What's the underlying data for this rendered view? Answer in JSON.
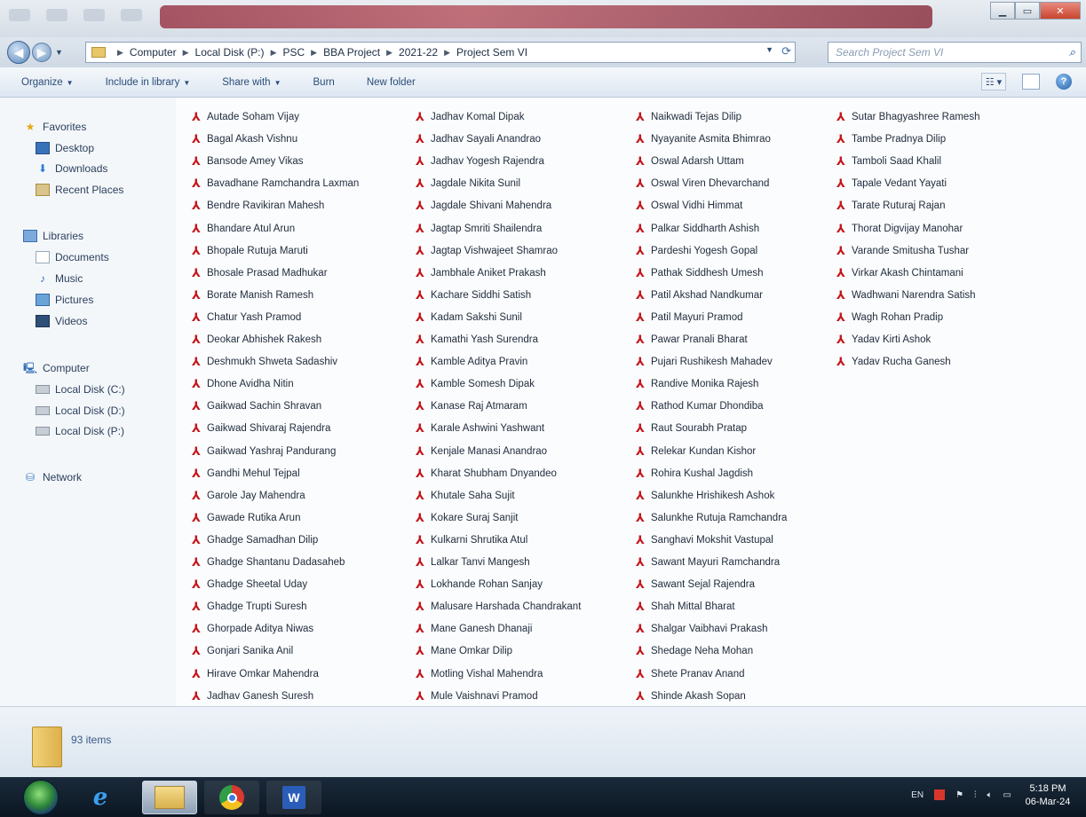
{
  "address": {
    "crumbs": [
      "Computer",
      "Local Disk (P:)",
      "PSC",
      "BBA Project",
      "2021-22",
      "Project Sem VI"
    ]
  },
  "search": {
    "placeholder": "Search Project Sem VI"
  },
  "commands": {
    "organize": "Organize",
    "include": "Include in library",
    "share": "Share with",
    "burn": "Burn",
    "newfolder": "New folder"
  },
  "nav": {
    "favorites": "Favorites",
    "desktop": "Desktop",
    "downloads": "Downloads",
    "recent": "Recent Places",
    "libraries": "Libraries",
    "documents": "Documents",
    "music": "Music",
    "pictures": "Pictures",
    "videos": "Videos",
    "computer": "Computer",
    "disk_c": "Local Disk (C:)",
    "disk_d": "Local Disk (D:)",
    "disk_p": "Local Disk (P:)",
    "network": "Network"
  },
  "files": {
    "col1": [
      "Autade Soham Vijay",
      "Bagal Akash Vishnu",
      "Bansode Amey Vikas",
      "Bavadhane Ramchandra Laxman",
      "Bendre Ravikiran Mahesh",
      "Bhandare Atul Arun",
      "Bhopale Rutuja Maruti",
      "Bhosale Prasad Madhukar",
      "Borate Manish Ramesh",
      "Chatur Yash Pramod",
      "Deokar Abhishek Rakesh",
      "Deshmukh Shweta Sadashiv",
      "Dhone Avidha Nitin",
      "Gaikwad Sachin Shravan",
      "Gaikwad Shivaraj Rajendra",
      "Gaikwad Yashraj Pandurang",
      "Gandhi Mehul Tejpal",
      "Garole Jay Mahendra",
      "Gawade Rutika Arun",
      "Ghadge Samadhan Dilip",
      "Ghadge Shantanu Dadasaheb",
      "Ghadge Sheetal Uday",
      "Ghadge Trupti Suresh",
      "Ghorpade Aditya Niwas",
      "Gonjari Sanika Anil",
      "Hirave Omkar Mahendra",
      "Jadhav Ganesh Suresh"
    ],
    "col2": [
      "Jadhav Komal Dipak",
      "Jadhav Sayali Anandrao",
      "Jadhav Yogesh Rajendra",
      "Jagdale Nikita Sunil",
      "Jagdale Shivani Mahendra",
      "Jagtap Smriti Shailendra",
      "Jagtap Vishwajeet Shamrao",
      "Jambhale Aniket Prakash",
      "Kachare Siddhi Satish",
      "Kadam Sakshi Sunil",
      "Kamathi Yash Surendra",
      "Kamble Aditya Pravin",
      "Kamble Somesh Dipak",
      "Kanase Raj Atmaram",
      "Karale Ashwini Yashwant",
      "Kenjale Manasi Anandrao",
      "Kharat Shubham Dnyandeo",
      "Khutale Saha Sujit",
      "Kokare Suraj Sanjit",
      "Kulkarni Shrutika Atul",
      "Lalkar Tanvi Mangesh",
      "Lokhande Rohan Sanjay",
      "Malusare Harshada Chandrakant",
      "Mane Ganesh Dhanaji",
      "Mane Omkar Dilip",
      "Motling Vishal Mahendra",
      "Mule Vaishnavi Pramod"
    ],
    "col3": [
      "Naikwadi Tejas Dilip",
      "Nyayanite Asmita Bhimrao",
      "Oswal Adarsh Uttam",
      "Oswal Viren Dhevarchand",
      "Oswal Vidhi Himmat",
      "Palkar Siddharth Ashish",
      "Pardeshi Yogesh Gopal",
      "Pathak Siddhesh Umesh",
      "Patil Akshad Nandkumar",
      "Patil Mayuri Pramod",
      "Pawar Pranali Bharat",
      "Pujari Rushikesh Mahadev",
      "Randive Monika Rajesh",
      "Rathod Kumar Dhondiba",
      "Raut Sourabh Pratap",
      "Relekar Kundan Kishor",
      "Rohira Kushal Jagdish",
      "Salunkhe Hrishikesh Ashok",
      "Salunkhe Rutuja Ramchandra",
      "Sanghavi Mokshit Vastupal",
      "Sawant Mayuri Ramchandra",
      "Sawant Sejal Rajendra",
      "Shah Mittal Bharat",
      "Shalgar Vaibhavi Prakash",
      "Shedage Neha Mohan",
      "Shete Pranav Anand",
      "Shinde Akash Sopan"
    ],
    "col4": [
      "Sutar Bhagyashree Ramesh",
      "Tambe Pradnya Dilip",
      "Tamboli Saad Khalil",
      "Tapale Vedant Yayati",
      "Tarate Ruturaj Rajan",
      "Thorat Digvijay Manohar",
      "Varande Smitusha Tushar",
      "Virkar Akash Chintamani",
      "Wadhwani Narendra Satish",
      "Wagh Rohan Pradip",
      "Yadav Kirti Ashok",
      "Yadav Rucha Ganesh"
    ]
  },
  "details": {
    "count": "93 items"
  },
  "taskbar": {
    "lang": "EN",
    "time": "5:18 PM",
    "date": "06-Mar-24"
  }
}
